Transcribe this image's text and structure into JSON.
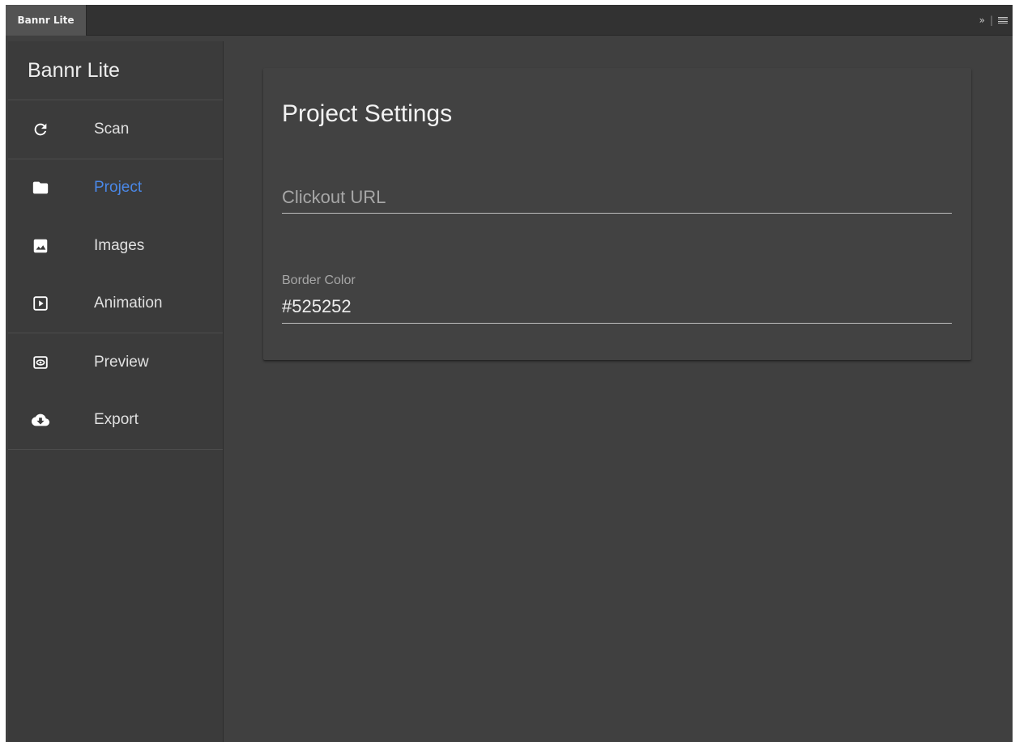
{
  "window": {
    "tab_title": "Bannr Lite",
    "collapse_glyph": "»",
    "separator": "|"
  },
  "sidebar": {
    "brand": "Bannr Lite",
    "items": [
      {
        "label": "Scan",
        "icon": "refresh-icon",
        "active": false
      },
      {
        "label": "Project",
        "icon": "folder-icon",
        "active": true
      },
      {
        "label": "Images",
        "icon": "image-icon",
        "active": false
      },
      {
        "label": "Animation",
        "icon": "play-icon",
        "active": false
      },
      {
        "label": "Preview",
        "icon": "eye-icon",
        "active": false
      },
      {
        "label": "Export",
        "icon": "cloud-download-icon",
        "active": false
      }
    ]
  },
  "main": {
    "title": "Project Settings",
    "clickout": {
      "placeholder": "Clickout URL",
      "value": ""
    },
    "border_color": {
      "label": "Border Color",
      "value": "#525252"
    }
  },
  "colors": {
    "accent": "#4a88e8",
    "panel_bg": "#404040",
    "sidebar_bg": "#3b3b3b"
  }
}
